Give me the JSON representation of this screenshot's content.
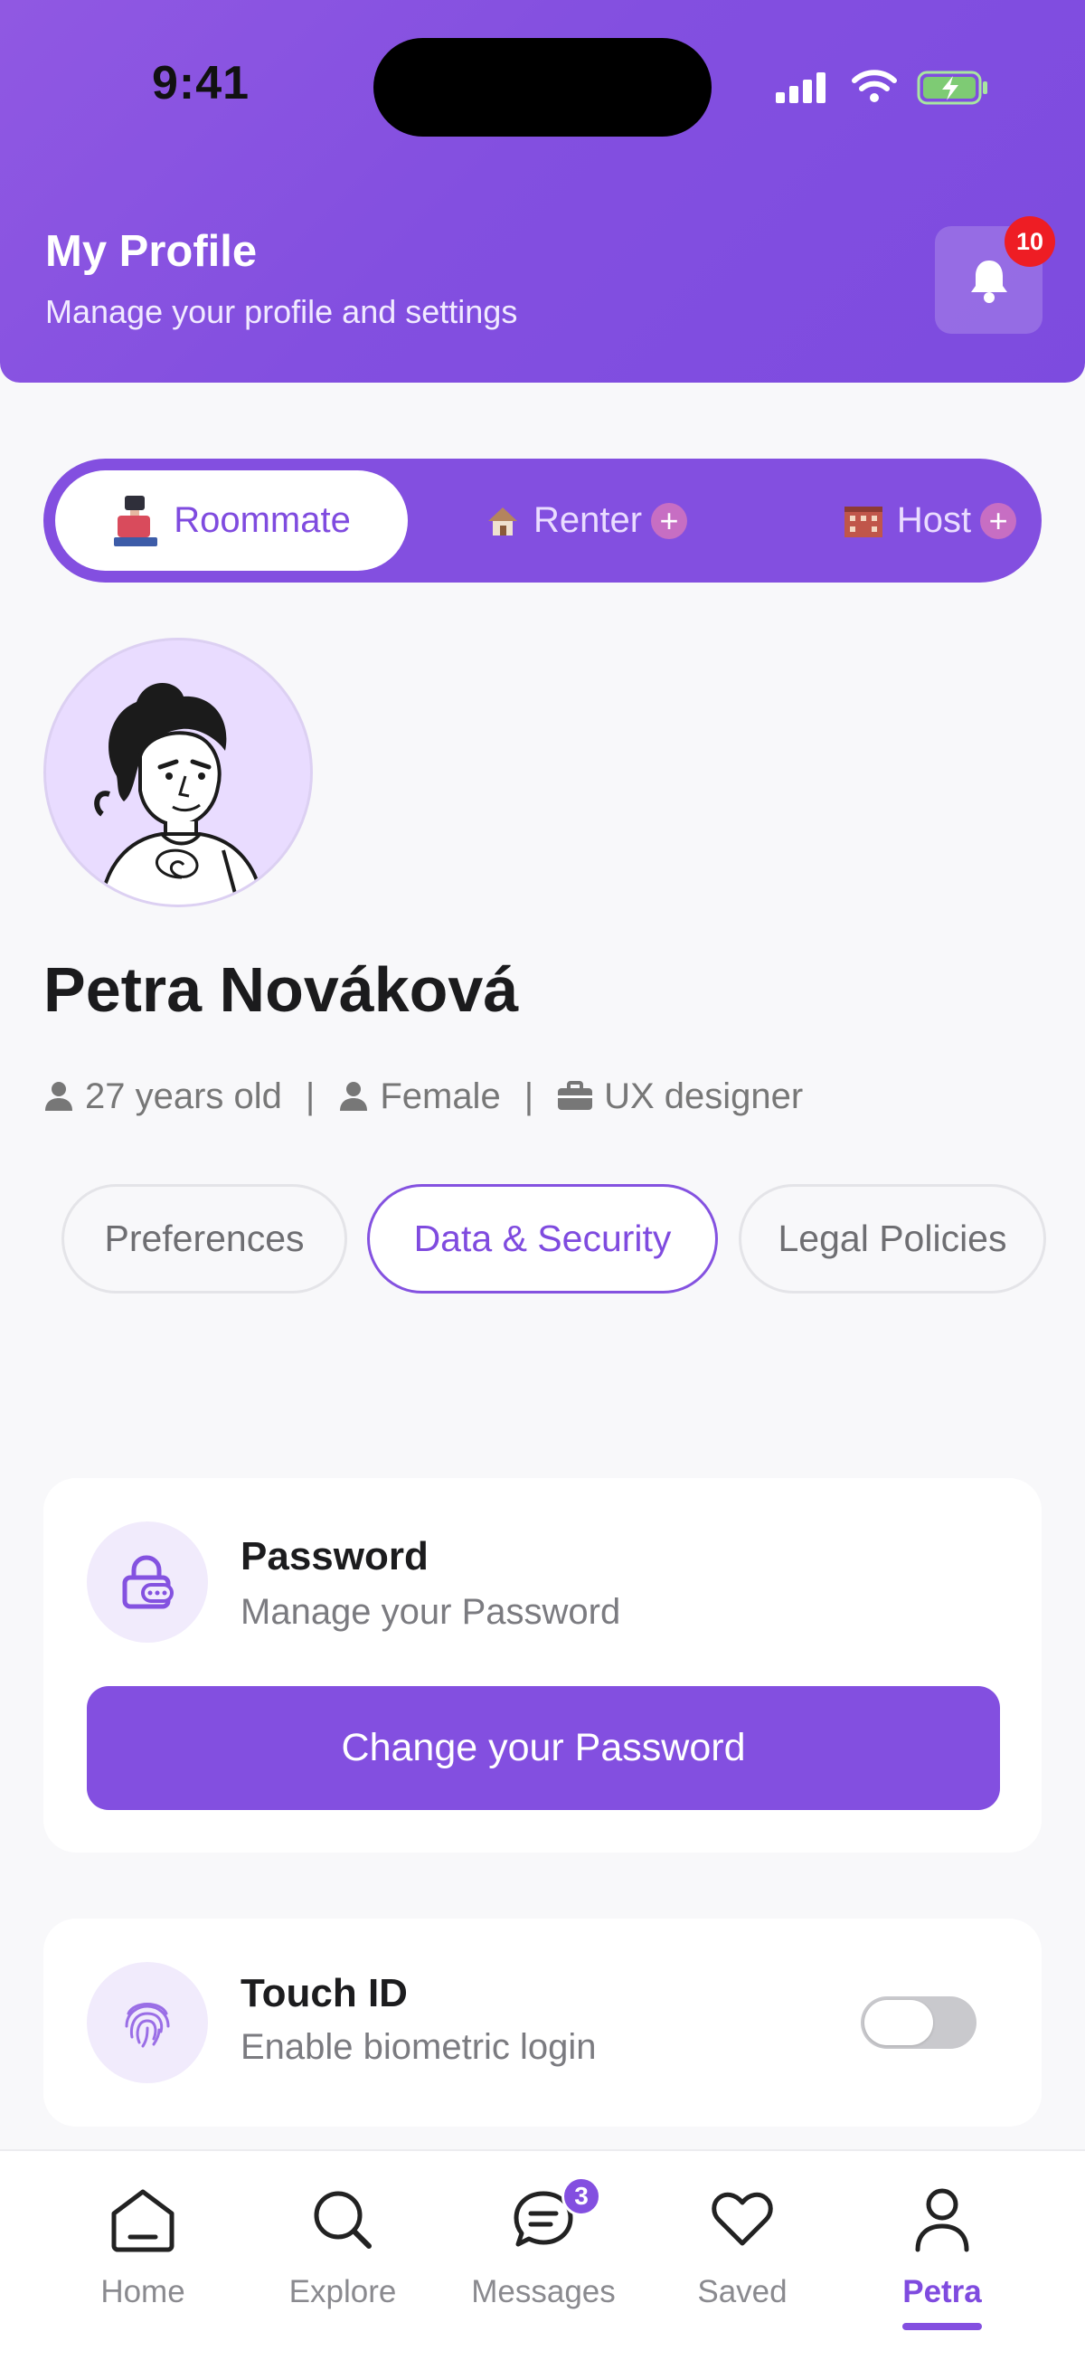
{
  "status_bar": {
    "time": "9:41"
  },
  "header": {
    "title": "My Profile",
    "subtitle": "Manage your profile and settings",
    "notification_count": "10"
  },
  "roles": {
    "roommate": "Roommate",
    "renter": "Renter",
    "host": "Host",
    "plus": "+"
  },
  "profile": {
    "name": "Petra Nováková",
    "age": "27 years old",
    "gender": "Female",
    "occupation": "UX designer",
    "separator": "|"
  },
  "tabs": {
    "preferences": "Preferences",
    "data_security": "Data & Security",
    "legal": "Legal Policies"
  },
  "password_card": {
    "title": "Password",
    "subtitle": "Manage your Password",
    "button": "Change your Password"
  },
  "touch_card": {
    "title": "Touch ID",
    "subtitle": "Enable biometric login",
    "enabled": false
  },
  "nav": {
    "home": "Home",
    "explore": "Explore",
    "messages": "Messages",
    "messages_badge": "3",
    "saved": "Saved",
    "profile": "Petra"
  },
  "colors": {
    "accent": "#834fe0",
    "badge_red": "#ee1d24"
  }
}
